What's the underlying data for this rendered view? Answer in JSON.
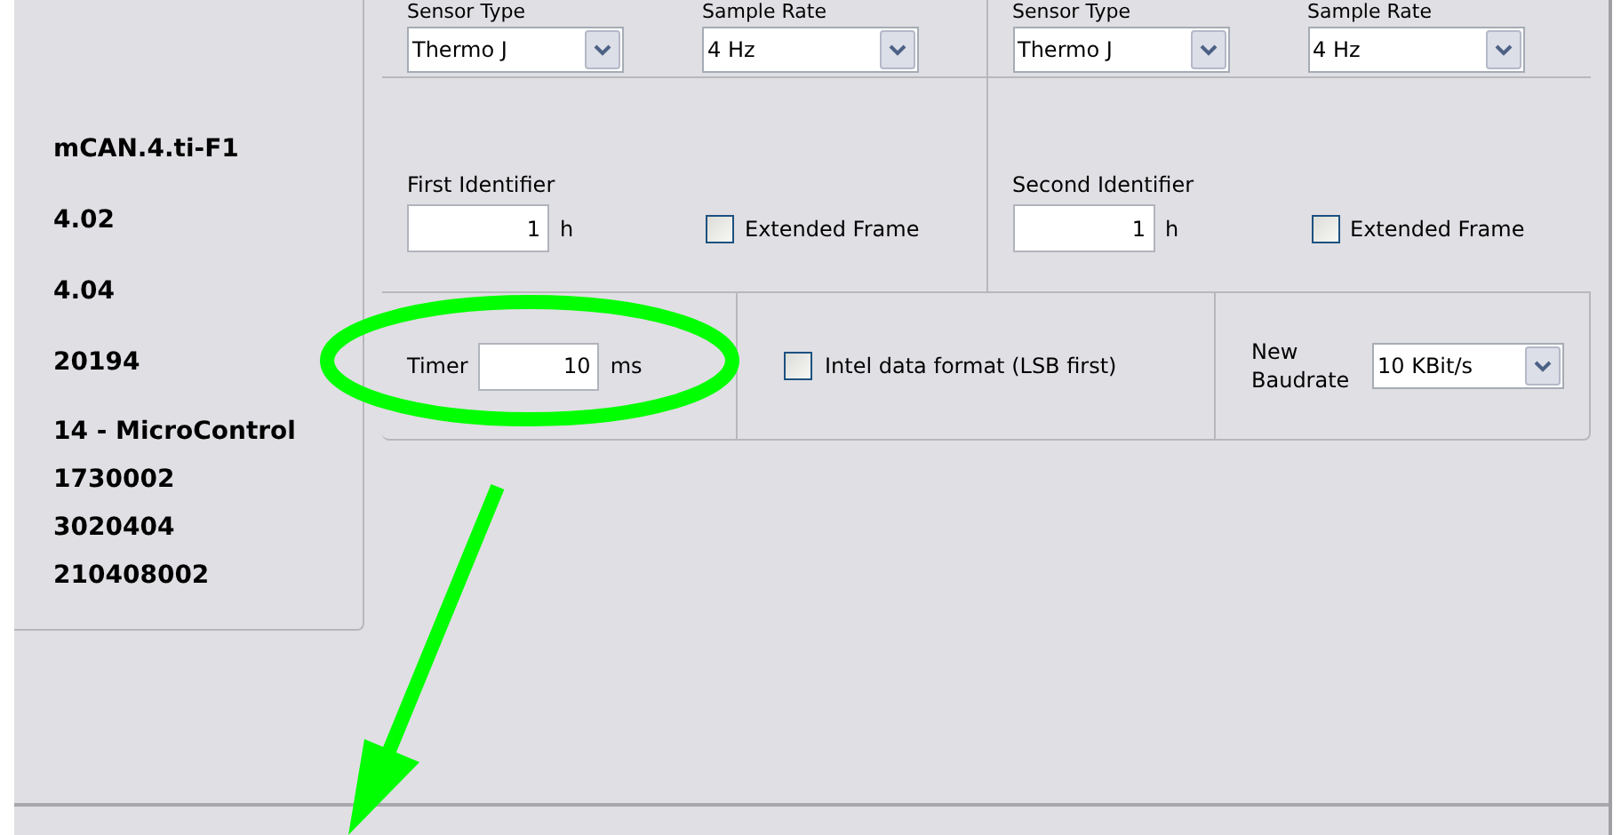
{
  "info": [
    "mCAN.4.ti-F1",
    "4.02",
    "4.04",
    "20194",
    "14 - MicroControl",
    "1730002",
    "3020404",
    "210408002"
  ],
  "sensors": [
    {
      "type_label": "Sensor Type",
      "type_value": "Thermo J",
      "rate_label": "Sample Rate",
      "rate_value": "4 Hz"
    },
    {
      "type_label": "Sensor Type",
      "type_value": "Thermo J",
      "rate_label": "Sample Rate",
      "rate_value": "4 Hz"
    }
  ],
  "identifiers": [
    {
      "label": "First Identifier",
      "value": "1",
      "unit": "h",
      "extended_label": "Extended Frame",
      "extended_checked": false
    },
    {
      "label": "Second Identifier",
      "value": "1",
      "unit": "h",
      "extended_label": "Extended Frame",
      "extended_checked": false
    }
  ],
  "timer": {
    "label": "Timer",
    "value": "10",
    "unit": "ms"
  },
  "intel_format": {
    "label": "Intel data format (LSB first)",
    "checked": false
  },
  "baudrate": {
    "label": "New Baudrate",
    "value": "10 KBit/s"
  }
}
